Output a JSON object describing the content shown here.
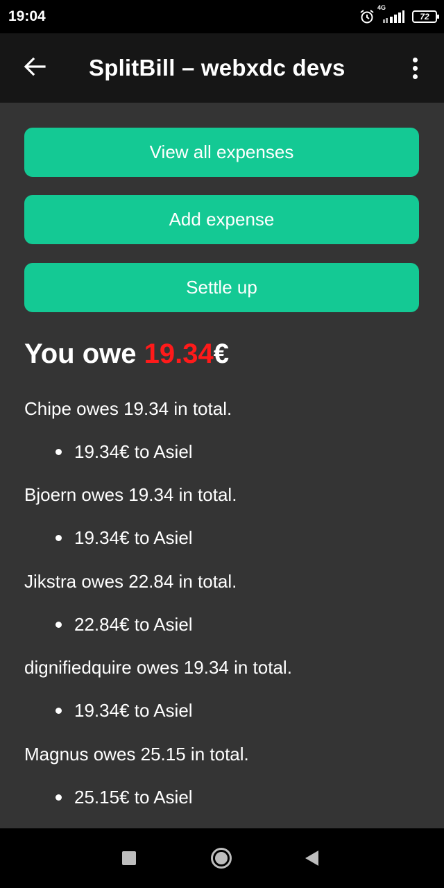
{
  "status_bar": {
    "time": "19:04",
    "network": "4G",
    "battery": "72"
  },
  "app_bar": {
    "title": "SplitBill – webxdc devs",
    "back_icon": "arrow-left-icon",
    "menu_icon": "more-vert-icon"
  },
  "actions": {
    "view_all": "View all expenses",
    "add": "Add expense",
    "settle": "Settle up"
  },
  "summary": {
    "prefix": "You owe ",
    "amount": "19.34",
    "currency": "€",
    "amount_color": "#ff1a1a"
  },
  "debts": [
    {
      "line": "Chipe owes 19.34 in total.",
      "item": "19.34€ to Asiel"
    },
    {
      "line": "Bjoern owes 19.34 in total.",
      "item": "19.34€ to Asiel"
    },
    {
      "line": "Jikstra owes 22.84 in total.",
      "item": "22.84€ to Asiel"
    },
    {
      "line": "dignifiedquire owes 19.34 in total.",
      "item": "19.34€ to Asiel"
    },
    {
      "line": "Magnus owes 25.15 in total.",
      "item": "25.15€ to Asiel"
    }
  ],
  "colors": {
    "accent": "#14c994",
    "background": "#343434",
    "app_bar": "#161616"
  }
}
